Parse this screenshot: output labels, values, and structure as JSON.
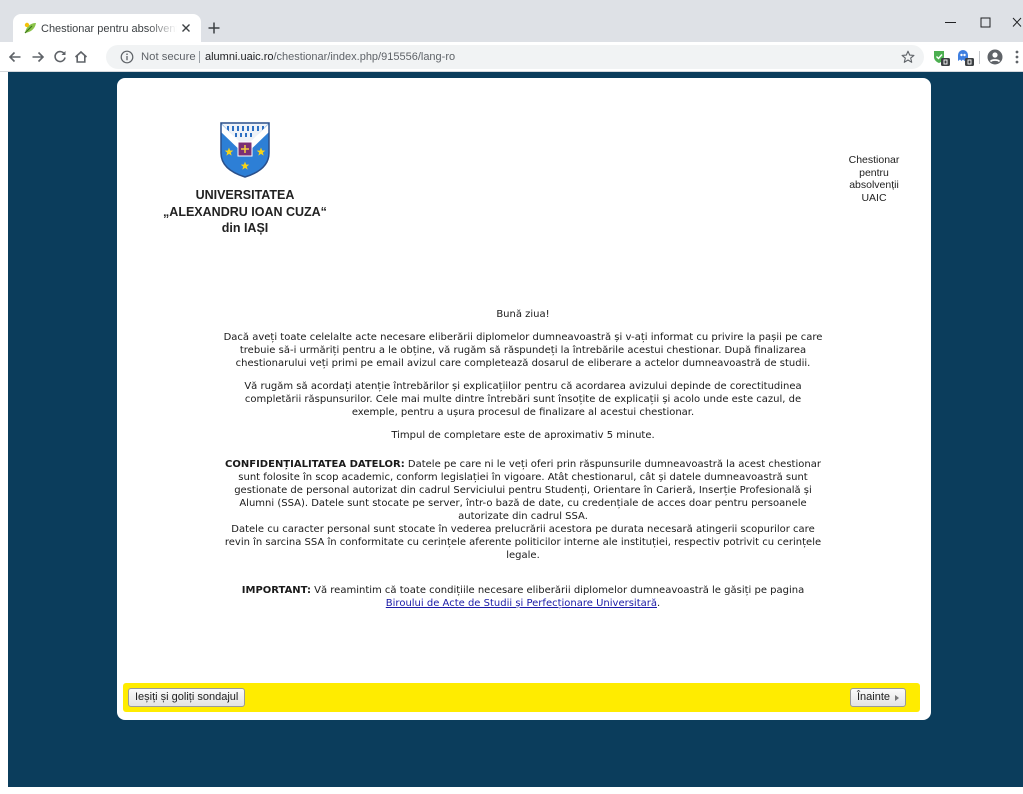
{
  "browser": {
    "tab": {
      "title": "Chestionar pentru absolvenții UA",
      "favicon": "survey-leaf-icon",
      "close_icon": "close-icon"
    },
    "new_tab_icon": "plus-icon",
    "window_controls": [
      "minimize-icon",
      "maximize-icon",
      "close-icon"
    ],
    "nav_icons": [
      "back-arrow-icon",
      "forward-arrow-icon",
      "reload-icon",
      "home-icon"
    ],
    "omnibox": {
      "security_icon": "info-icon",
      "security_label": "Not secure",
      "url_host": "alumni.uaic.ro",
      "url_path": "/chestionar/index.php/915556/lang-ro",
      "bookmark_icon": "star-icon"
    },
    "toolbar_icons": [
      "extension-icon",
      "extension-icon",
      "profile-icon",
      "menu-icon"
    ]
  },
  "header": {
    "logo_icon": "uaic-crest-icon",
    "university_lines": [
      "UNIVERSITATEA",
      "„ALEXANDRU IOAN CUZA“",
      "din IAȘI"
    ],
    "survey_title": "Chestionar pentru absolvenții UAIC"
  },
  "welcome": {
    "greeting": "Bună ziua!",
    "paragraphs": [
      "Dacă aveți toate celelalte acte necesare eliberării diplomelor dumneavoastră și v-ați informat cu privire la pașii pe care trebuie să-i urmăriți pentru a le obține, vă rugăm să răspundeți la întrebările acestui chestionar. După finalizarea chestionarului veți primi pe email avizul care completează dosarul de eliberare a actelor dumneavoastră de studii.",
      "Vă rugăm să acordați atenție întrebărilor și explicațiilor pentru că acordarea avizului depinde de corectitudinea completării răspunsurilor. Cele mai multe dintre întrebări sunt însoțite de explicații și acolo unde este cazul, de exemple, pentru a ușura procesul de finalizare al acestui chestionar."
    ],
    "timing": "Timpul de completare este de aproximativ 5 minute.",
    "confidentiality": {
      "label": "CONFIDENȚIALITATEA DATELOR:",
      "text": "Datele pe care ni le veți oferi prin răspunsurile dumneavoastră la acest chestionar sunt folosite în scop academic, conform legislației în vigoare. Atât chestionarul, cât și datele dumneavoastră sunt gestionate de personal autorizat din cadrul Serviciului pentru Studenți, Orientare în Carieră, Inserție Profesională și Alumni (SSA). Datele sunt stocate pe server, într-o bază de date, cu credențiale de acces doar pentru persoanele autorizate din cadrul SSA.",
      "text_2": "Datele cu caracter personal sunt stocate în vederea prelucrării acestora pe durata necesară atingerii scopurilor care revin în sarcina SSA în conformitate cu cerințele aferente politicilor interne ale instituției, respectiv potrivit cu cerințele legale."
    },
    "important": {
      "label": "IMPORTANT:",
      "text": "Vă reamintim că toate condițiile necesare eliberării diplomelor dumneavoastră le găsiți pe pagina",
      "link": "Biroului de Acte de Studii și Perfecționare Universitară",
      "suffix": "."
    }
  },
  "navigation": {
    "exit_label": "Ieșiți și goliți sondajul",
    "next_label": "Înainte",
    "next_icon": "triangle-right-icon"
  },
  "colors": {
    "page_background": "#0b3d5c",
    "card_background": "#ffffff",
    "nav_bar_background": "#ffec00",
    "link": "#1a1aa6",
    "text": "#1a1a1a"
  }
}
